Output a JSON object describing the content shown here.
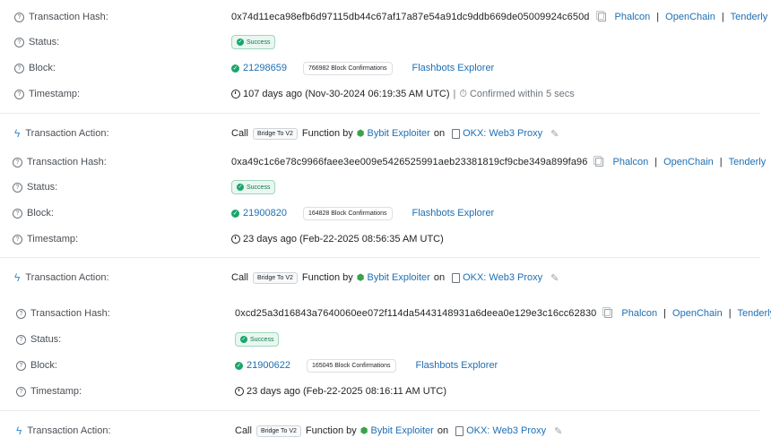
{
  "labels": {
    "tx_hash": "Transaction Hash:",
    "status": "Status:",
    "block": "Block:",
    "timestamp": "Timestamp:",
    "action": "Transaction Action:"
  },
  "links": {
    "phalcon": "Phalcon",
    "openchain": "OpenChain",
    "tenderly": "Tenderly",
    "flashbots": "Flashbots Explorer",
    "separator": "|"
  },
  "status_text": "Success",
  "action": {
    "call": "Call",
    "function_tag": "Bridge To V2",
    "function_by": "Function by",
    "actor": "Bybit Exploiter",
    "on": "on",
    "target": "OKX: Web3 Proxy"
  },
  "transactions": [
    {
      "hash": "0x74d11eca98efb6d97115db44c67af17a87e54a91dc9ddb669de05009924c650d",
      "block": "21298659",
      "confirmations": "766982 Block Confirmations",
      "timestamp": "107 days ago (Nov-30-2024 06:19:35 AM UTC)",
      "confirmed_sep": "|",
      "confirmed": "Confirmed within 5 secs"
    },
    {
      "hash": "0xa49c1c6e78c9966faee3ee009e5426525991aeb23381819cf9cbe349a899fa96",
      "block": "21900820",
      "confirmations": "164828 Block Confirmations",
      "timestamp": "23 days ago (Feb-22-2025 08:56:35 AM UTC)"
    },
    {
      "hash": "0xcd25a3d16843a7640060ee072f114da5443148931a6deea0e129e3c16cc62830",
      "block": "21900622",
      "confirmations": "165045 Block Confirmations",
      "timestamp": "23 days ago (Feb-22-2025 08:16:11 AM UTC)"
    }
  ],
  "colors": {
    "link": "#1e6fb3",
    "success": "#18a66b",
    "accent_icon": "#3d8fd1"
  },
  "icons": {
    "help": "question-circle-icon",
    "bolt": "lightning-icon",
    "copy": "copy-icon",
    "check": "check-circle-icon",
    "clock": "clock-icon",
    "timer": "stopwatch-icon",
    "contract": "file-icon",
    "edit": "pencil-icon",
    "bot": "robot-icon"
  }
}
